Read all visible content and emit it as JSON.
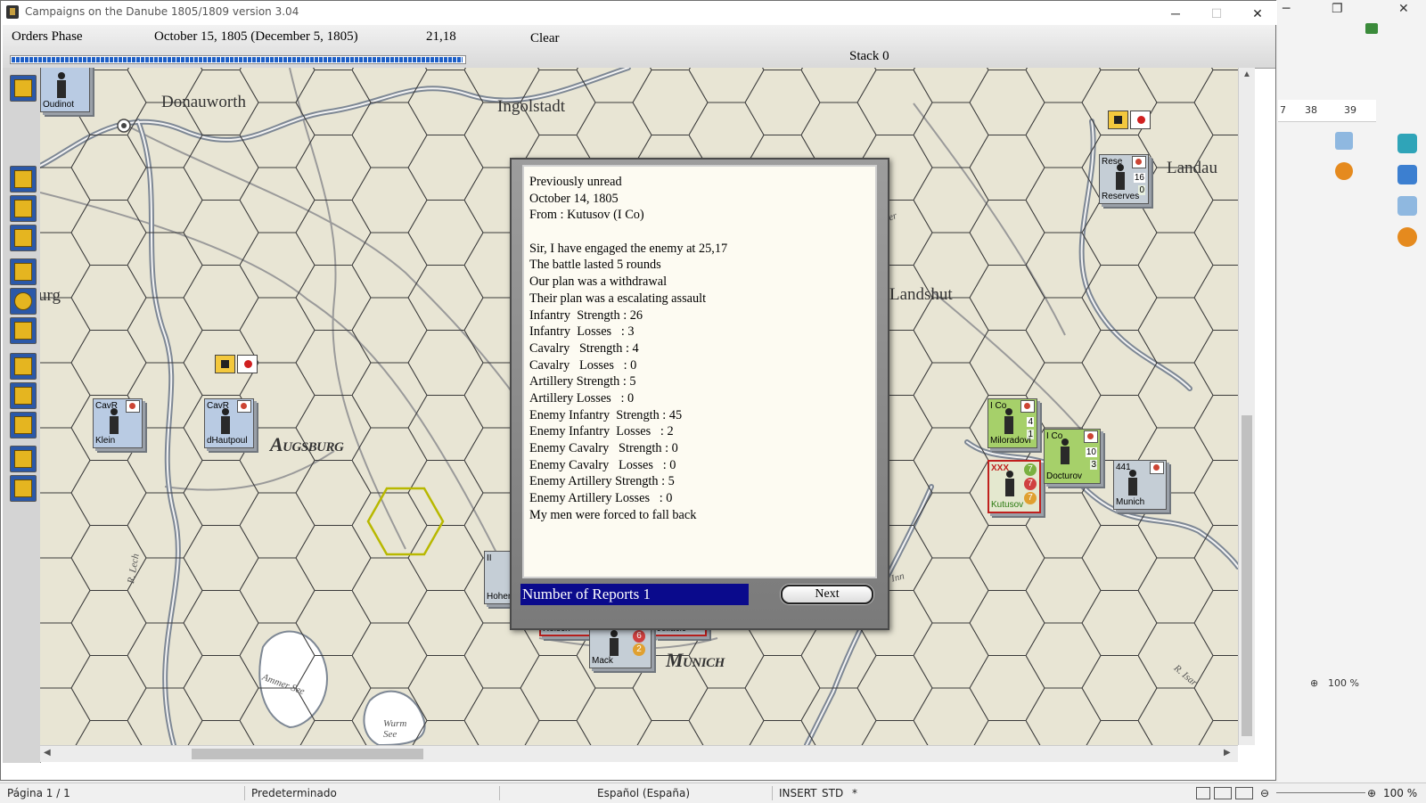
{
  "window": {
    "title": "Campaigns on the Danube 1805/1809  version 3.04"
  },
  "infobar": {
    "phase": "Orders Phase",
    "date": "October 15, 1805 (December 5, 1805)",
    "coords": "21,18",
    "clear_label": "Clear",
    "stack_label": "Stack 0",
    "progress_fraction": 1.0
  },
  "map_labels": {
    "donauworth": "Donauworth",
    "ingolstadt": "Ingolstadt",
    "landau": "Landau",
    "landshut": "Landshut",
    "augsburg": "Augsburg",
    "munich": "Munich",
    "burg_fragment": "urg",
    "river_lech": "R. Lech",
    "ammer_see": "Ammer See",
    "wurm_see": "Wurm See",
    "river_isar": "R. Isar",
    "inn_fragment": "Inn",
    "iser_fragment": "ser"
  },
  "counters": [
    {
      "id": "oudinot",
      "name": "Oudinot",
      "type": ""
    },
    {
      "id": "klein",
      "name": "Klein",
      "type": "CavR"
    },
    {
      "id": "dhautpoul",
      "name": "dHautpoul",
      "type": "CavR"
    },
    {
      "id": "reserves",
      "name": "Reserves",
      "type": "Rese",
      "v1": "16",
      "v2": "0"
    },
    {
      "id": "miloradovi",
      "name": "Miloradovi",
      "type": "I Co",
      "v1": "4",
      "v2": "1"
    },
    {
      "id": "kutusov",
      "name": "Kutusov",
      "type": "XXX",
      "v1": "7",
      "v2": "7",
      "v3": "7"
    },
    {
      "id": "docturov",
      "name": "Docturov",
      "type": "I Co",
      "v1": "10",
      "v2": "3"
    },
    {
      "id": "munich",
      "name": "Munich",
      "type": "441"
    },
    {
      "id": "mack",
      "name": "Mack",
      "v1": "6",
      "v2": "2"
    },
    {
      "id": "hohen",
      "name": "Hohen",
      "type": "II"
    },
    {
      "id": "reisch",
      "name": "Reisch"
    },
    {
      "id": "jellacic",
      "name": "Jellacic"
    }
  ],
  "dialog": {
    "lines": [
      "Previously unread",
      "October 14, 1805",
      "From : Kutusov (I Co)",
      "",
      "Sir, I have engaged the enemy at 25,17",
      "The battle lasted 5 rounds",
      "Our plan was a withdrawal",
      "Their plan was a escalating assault",
      "Infantry  Strength : 26",
      "Infantry  Losses   : 3",
      "Cavalry   Strength : 4",
      "Cavalry   Losses   : 0",
      "Artillery Strength : 5",
      "Artillery Losses   : 0",
      "Enemy Infantry  Strength : 45",
      "Enemy Infantry  Losses   : 2",
      "Enemy Cavalry   Strength : 0",
      "Enemy Cavalry   Losses   : 0",
      "Enemy Artillery Strength : 5",
      "Enemy Artillery Losses   : 0",
      "My men were forced to fall back"
    ],
    "report_count": "Number of Reports 1",
    "next_label": "Next"
  },
  "background_app": {
    "ruler_marks": [
      "7",
      "38",
      "39"
    ],
    "zoom": "100 %"
  },
  "statusbar": {
    "page": "Página  1 / 1",
    "style": "Predeterminado",
    "language": "Español (España)",
    "mode": "INSERT",
    "std": "STD",
    "asterisk": "*",
    "zoom": "100 %"
  },
  "colors": {
    "report_bar": "#0a0a8c",
    "progress": "#1d5fc7",
    "map_paper": "#e8e5d4",
    "allied_green": "#a6d06a",
    "french_blue": "#b9cbe3"
  }
}
